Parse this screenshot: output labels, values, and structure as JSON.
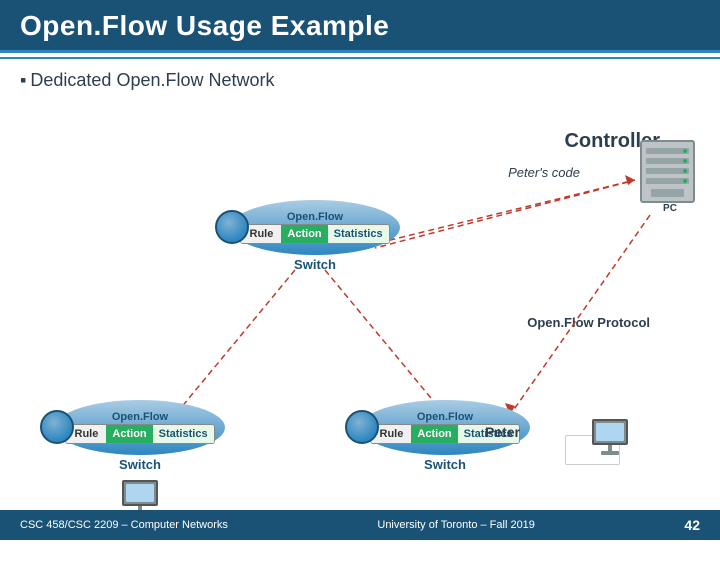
{
  "header": {
    "title": "Open.Flow Usage Example"
  },
  "subtitle": "Dedicated Open.Flow Network",
  "controller": {
    "label": "Controller",
    "pc_label": "PC"
  },
  "peters_code": "Peter's code",
  "of_protocol": "Open.Flow\nProtocol",
  "peter_label": "Peter",
  "center_switch": {
    "of_label": "Open.Flow",
    "rule": "Rule",
    "action": "Action",
    "stats": "Statistics",
    "switch_label": "Switch"
  },
  "left_switch": {
    "of_label": "Open.Flow",
    "rule": "Rule",
    "action": "Action",
    "stats": "Statistics",
    "switch_label": "Switch"
  },
  "right_switch": {
    "of_label": "Open.Flow",
    "rule": "Rule",
    "action": "Action",
    "stats": "Statistics",
    "switch_label": "Switch"
  },
  "footer": {
    "left": "CSC 458/CSC 2209 – Computer Networks",
    "center": "University of Toronto – Fall 2019",
    "right": "42"
  }
}
